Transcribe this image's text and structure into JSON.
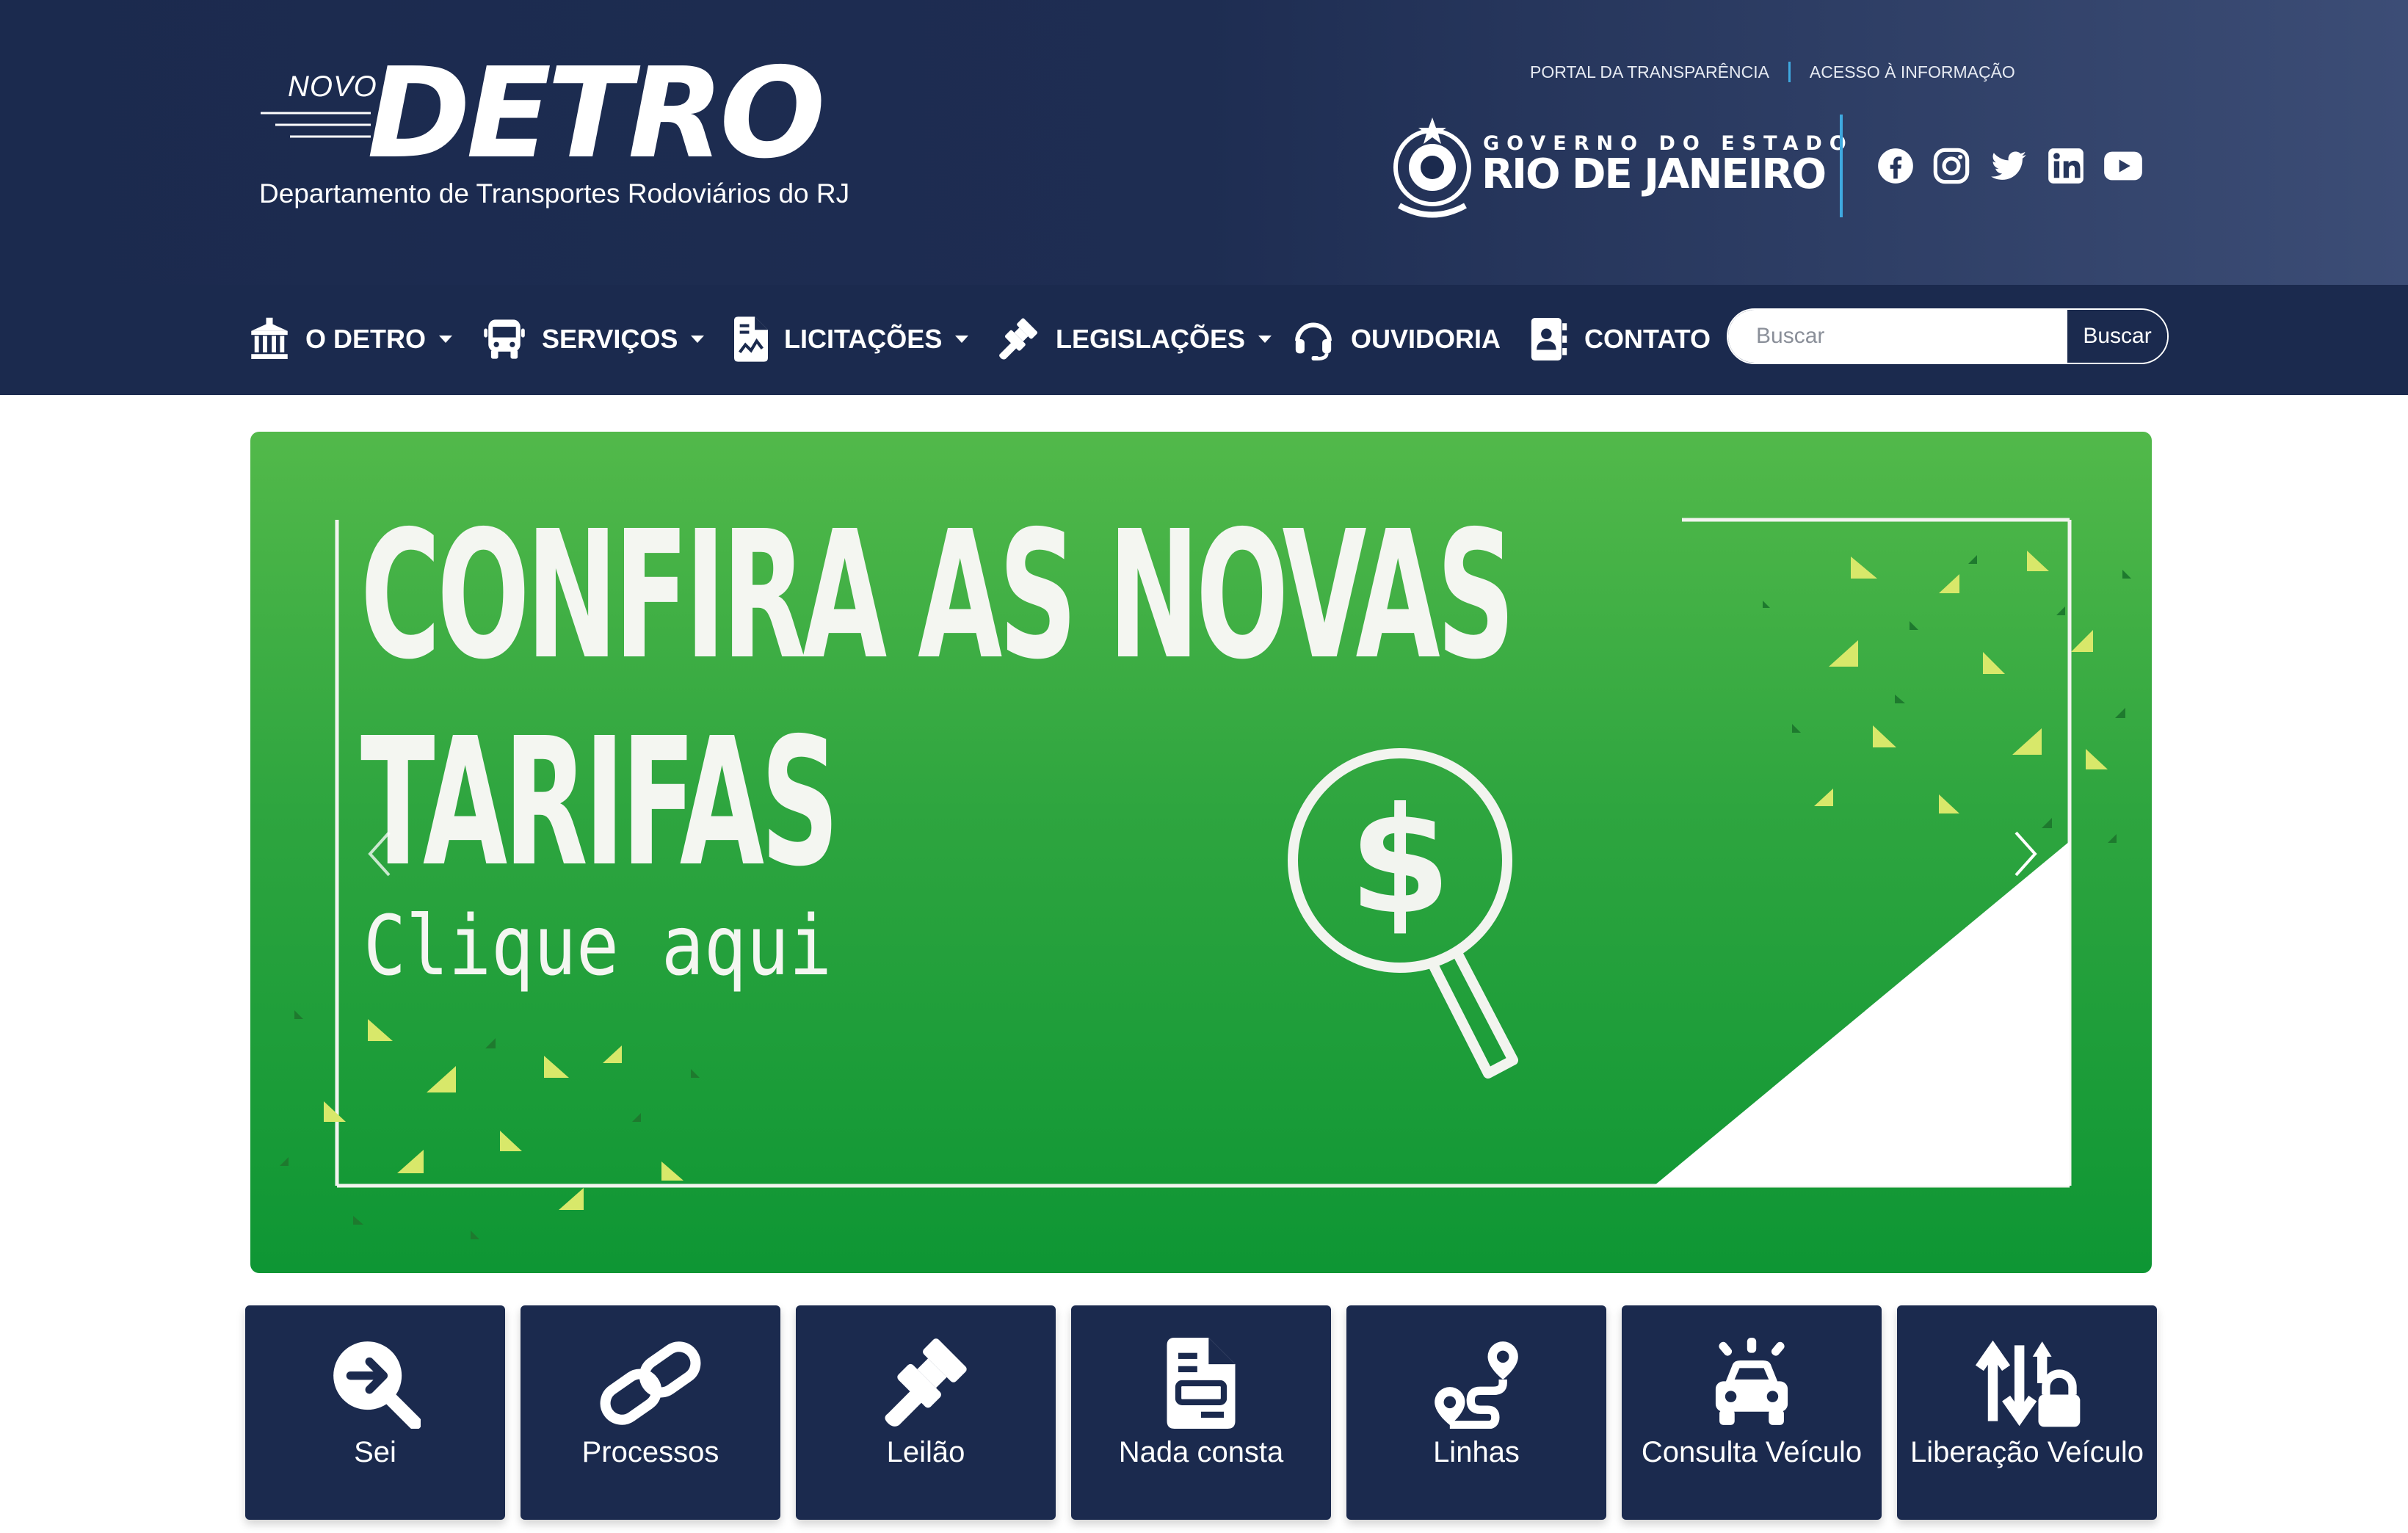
{
  "header": {
    "logo_novo": "NOVO",
    "logo_main": "DETRO",
    "logo_subtitle": "Departamento de Transportes Rodoviários do RJ",
    "top_links": [
      "PORTAL DA TRANSPARÊNCIA",
      "ACESSO À INFORMAÇÃO"
    ],
    "gov_line1": "GOVERNO DO ESTADO",
    "gov_line2": "RIO DE JANEIRO",
    "social_icons": [
      "facebook-icon",
      "instagram-icon",
      "twitter-icon",
      "linkedin-icon",
      "youtube-icon"
    ]
  },
  "nav": {
    "items": [
      {
        "label": "O DETRO",
        "icon": "building-icon",
        "dropdown": true
      },
      {
        "label": "SERVIÇOS",
        "icon": "bus-icon",
        "dropdown": true
      },
      {
        "label": "LICITAÇÕES",
        "icon": "document-icon",
        "dropdown": true
      },
      {
        "label": "LEGISLAÇÕES",
        "icon": "gavel-icon",
        "dropdown": true
      },
      {
        "label": "OUVIDORIA",
        "icon": "headset-icon",
        "dropdown": false
      },
      {
        "label": "CONTATO",
        "icon": "contact-icon",
        "dropdown": false
      }
    ],
    "search_placeholder": "Buscar",
    "search_button": "Buscar"
  },
  "banner": {
    "line1": "CONFIRA AS NOVAS",
    "line2": "TARIFAS",
    "subtitle": "Clique aqui"
  },
  "tiles": [
    {
      "label": "Sei",
      "icon": "arrow-magnifier-icon"
    },
    {
      "label": "Processos",
      "icon": "link-icon"
    },
    {
      "label": "Leilão",
      "icon": "gavel-icon"
    },
    {
      "label": "Nada consta",
      "icon": "document-icon"
    },
    {
      "label": "Linhas",
      "icon": "route-icon"
    },
    {
      "label": "Consulta Veículo",
      "icon": "car-alert-icon"
    },
    {
      "label": "Liberação Veículo",
      "icon": "sort-lock-icon"
    }
  ],
  "colors": {
    "navy": "#1b2a4e",
    "accent_blue": "#3fa9e0",
    "banner_green": "#2ea53f",
    "triangle_yellow": "#d8e86a"
  }
}
